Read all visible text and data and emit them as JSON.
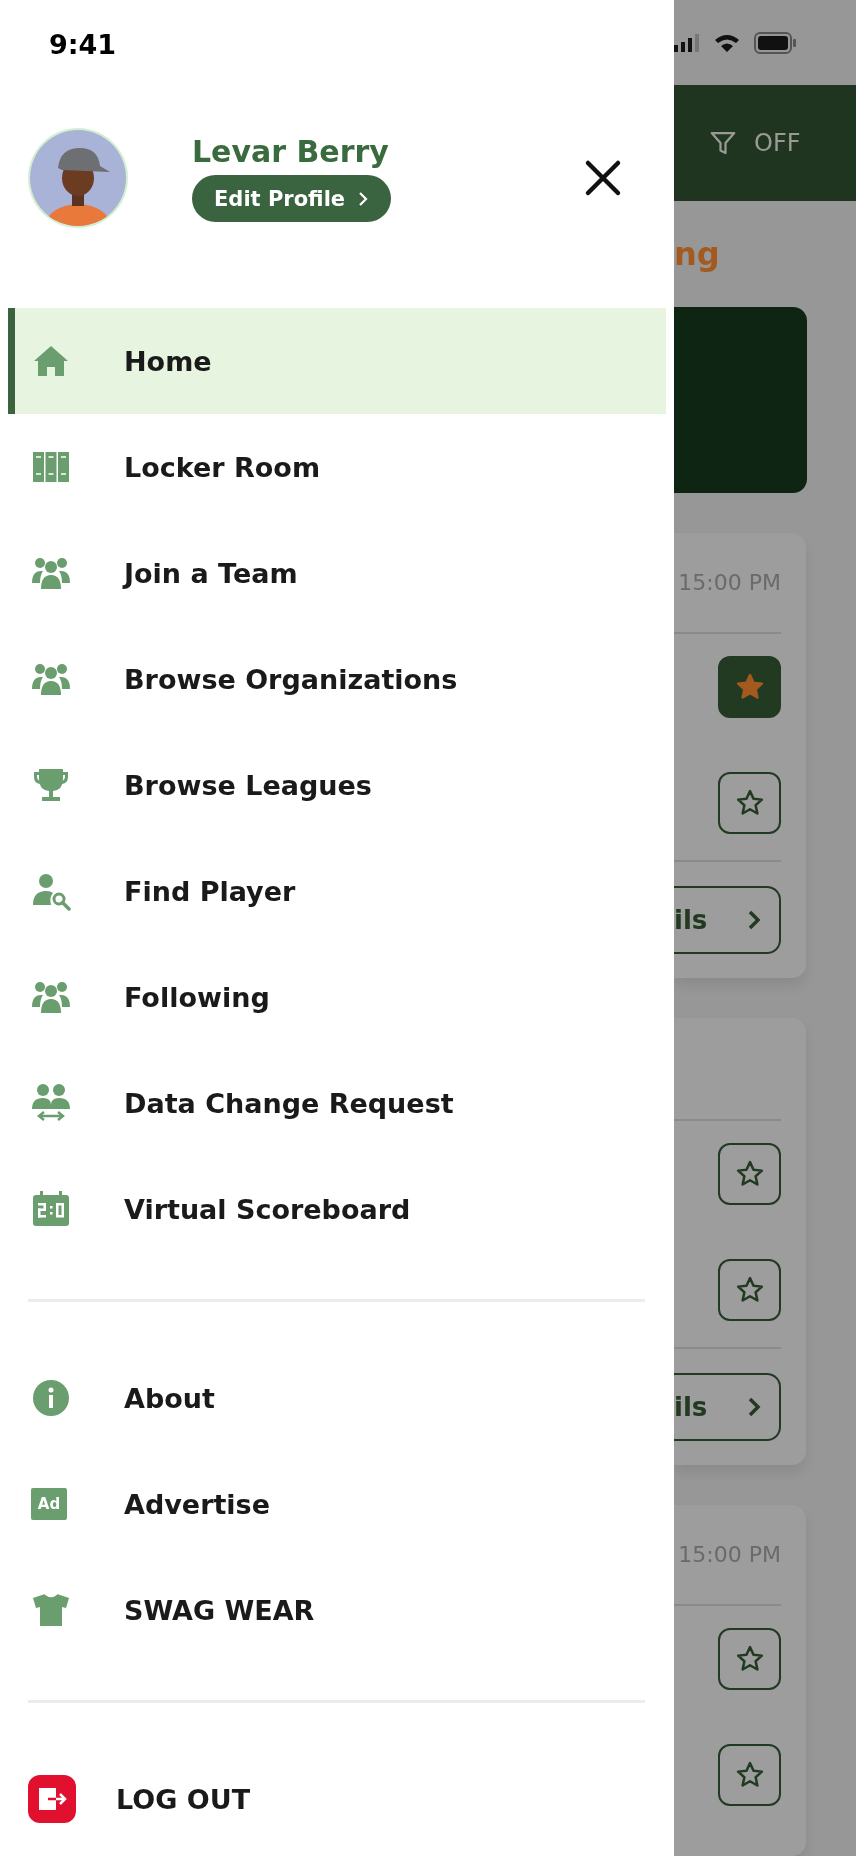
{
  "status_bar": {
    "time": "9:41"
  },
  "profile": {
    "name": "Levar Berry",
    "edit_button": "Edit Profile"
  },
  "menu": [
    {
      "label": "Home",
      "selected": true
    },
    {
      "label": "Locker Room",
      "selected": false
    },
    {
      "label": "Join a Team",
      "selected": false
    },
    {
      "label": "Browse Organizations",
      "selected": false
    },
    {
      "label": "Browse Leagues",
      "selected": false
    },
    {
      "label": "Find Player",
      "selected": false
    },
    {
      "label": "Following",
      "selected": false
    },
    {
      "label": "Data Change Request",
      "selected": false
    },
    {
      "label": "Virtual Scoreboard",
      "selected": false
    }
  ],
  "secondary_menu": [
    {
      "label": "About"
    },
    {
      "label": "Advertise",
      "badge": "Ad"
    },
    {
      "label": "SWAG WEAR"
    }
  ],
  "logout": {
    "label": "LOG OUT"
  },
  "background": {
    "filter_label": "OFF",
    "section_title": "ng",
    "cards": [
      {
        "time": "15:00 PM",
        "favorites": [
          {
            "on": true
          },
          {
            "on": false
          }
        ],
        "details": "ils"
      },
      {
        "favorites": [
          {
            "on": false
          },
          {
            "on": false
          }
        ],
        "details": "ils"
      },
      {
        "time": "15:00 PM",
        "favorites": [
          {
            "on": false
          },
          {
            "on": false
          }
        ]
      }
    ]
  }
}
